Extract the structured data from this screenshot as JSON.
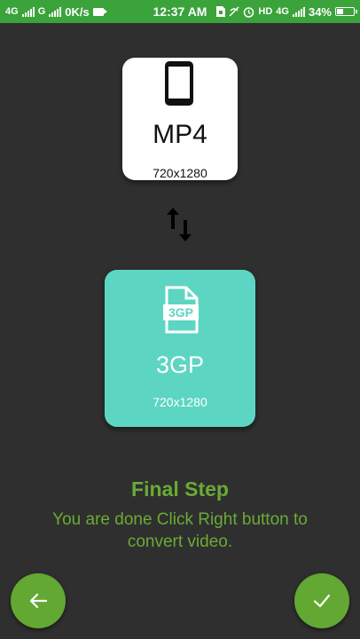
{
  "status_bar": {
    "network1": "4G",
    "network2": "G",
    "speed": "0K/s",
    "time": "12:37 AM",
    "hd": "HD",
    "network3": "4G",
    "battery": "34%",
    "battery_level": 0.34
  },
  "source_card": {
    "icon": "phone-icon",
    "format": "MP4",
    "resolution": "720x1280"
  },
  "swap_icon": "swap-vertical-icon",
  "target_card": {
    "icon_label": "3GP",
    "format": "3GP",
    "resolution": "720x1280",
    "color": "#5cd6c2"
  },
  "final_step": {
    "title": "Final Step",
    "message": "You are done Click Right button to convert video."
  },
  "buttons": {
    "back_icon": "arrow-left-icon",
    "confirm_icon": "check-icon",
    "color": "#63a832"
  }
}
